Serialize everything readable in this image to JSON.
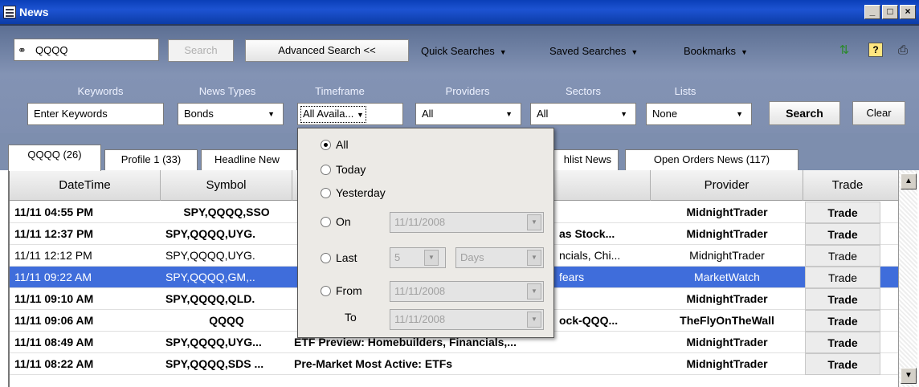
{
  "window": {
    "title": "News"
  },
  "toolbar": {
    "search_value": "QQQQ",
    "search_button": "Search",
    "advanced_search": "Advanced Search <<",
    "quick_searches": "Quick Searches",
    "saved_searches": "Saved Searches",
    "bookmarks": "Bookmarks"
  },
  "filters": {
    "keywords_label": "Keywords",
    "keywords_placeholder": "Enter Keywords",
    "news_types_label": "News Types",
    "news_types_value": "Bonds",
    "timeframe_label": "Timeframe",
    "timeframe_value": "All Availa...",
    "providers_label": "Providers",
    "providers_value": "All",
    "sectors_label": "Sectors",
    "sectors_value": "All",
    "lists_label": "Lists",
    "lists_value": "None",
    "search_button": "Search",
    "clear_button": "Clear"
  },
  "tabs": [
    {
      "label": "QQQQ (26)"
    },
    {
      "label": "Profile 1 (33)"
    },
    {
      "label": "Headline New"
    },
    {
      "label": "hlist News"
    },
    {
      "label": "Open Orders News (117)"
    }
  ],
  "grid": {
    "columns": [
      "DateTime",
      "Symbol",
      "",
      "Provider",
      "Trade"
    ],
    "rows": [
      {
        "datetime": "11/11 04:55 PM",
        "symbol": "SPY,QQQQ,SSO",
        "headline": "",
        "provider": "MidnightTrader",
        "trade": "Trade"
      },
      {
        "datetime": "11/11 12:37 PM",
        "symbol": "SPY,QQQQ,UYG.",
        "headline": "as Stock...",
        "provider": "MidnightTrader",
        "trade": "Trade"
      },
      {
        "datetime": "11/11 12:12 PM",
        "symbol": "SPY,QQQQ,UYG.",
        "headline": "ncials, Chi...",
        "provider": "MidnightTrader",
        "trade": "Trade"
      },
      {
        "datetime": "11/11 09:22 AM",
        "symbol": "SPY,QQQQ,GM,..",
        "headline": "fears",
        "provider": "MarketWatch",
        "trade": "Trade"
      },
      {
        "datetime": "11/11 09:10 AM",
        "symbol": "SPY,QQQQ,QLD.",
        "headline": "",
        "provider": "MidnightTrader",
        "trade": "Trade"
      },
      {
        "datetime": "11/11 09:06 AM",
        "symbol": "QQQQ",
        "headline": "ock-QQQ...",
        "provider": "TheFlyOnTheWall",
        "trade": "Trade"
      },
      {
        "datetime": "11/11 08:49 AM",
        "symbol": "SPY,QQQQ,UYG...",
        "headline": "ETF Preview: Homebuilders, Financials,...",
        "provider": "MidnightTrader",
        "trade": "Trade"
      },
      {
        "datetime": "11/11 08:22 AM",
        "symbol": "SPY,QQQQ,SDS ...",
        "headline": "Pre-Market Most Active: ETFs",
        "provider": "MidnightTrader",
        "trade": "Trade"
      }
    ]
  },
  "timeframe_popup": {
    "all": "All",
    "today": "Today",
    "yesterday": "Yesterday",
    "on": "On",
    "on_date": "11/11/2008",
    "last": "Last",
    "last_count": "5",
    "last_unit": "Days",
    "from": "From",
    "from_date": "11/11/2008",
    "to": "To",
    "to_date": "11/11/2008"
  }
}
